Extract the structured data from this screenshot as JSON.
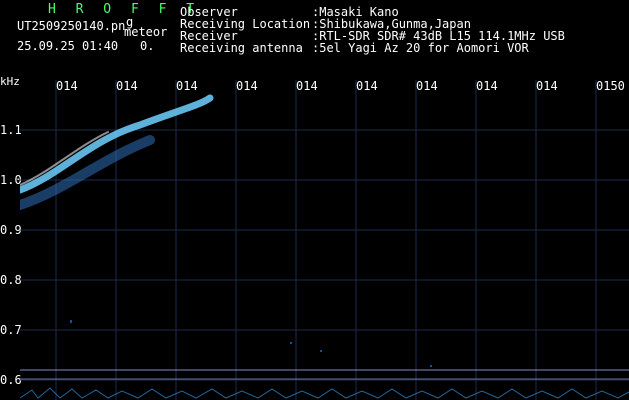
{
  "header": {
    "brand": "H R O F F T",
    "file_name": "UT2509250140.pn",
    "file_suffix": "g",
    "label_meteor": "meteor",
    "datetime": "25.09.25 01:40",
    "count": "0.",
    "fields": [
      {
        "label": "Observer",
        "value": ":Masaki Kano"
      },
      {
        "label": "Receiving Location",
        "value": ":Shibukawa,Gunma,Japan"
      },
      {
        "label": "Receiver",
        "value": ":RTL-SDR SDR# 43dB L15 114.1MHz USB"
      },
      {
        "label": "Receiving antenna",
        "value": ":5el Yagi Az 20 for Aomori VOR"
      }
    ]
  },
  "axis": {
    "unit": "kHz",
    "y_ticks": [
      "1.1",
      "1.0",
      "0.9",
      "0.8",
      "0.7",
      "0.6"
    ],
    "x_ticks": [
      "014",
      "014",
      "014",
      "014",
      "014",
      "014",
      "014",
      "014",
      "014",
      "0150"
    ]
  },
  "colors": {
    "background": "#000000",
    "grid": "#1b2a4a",
    "brand": "#49ff6b",
    "text": "#ffffff",
    "signal": "#6fd1ff"
  }
}
